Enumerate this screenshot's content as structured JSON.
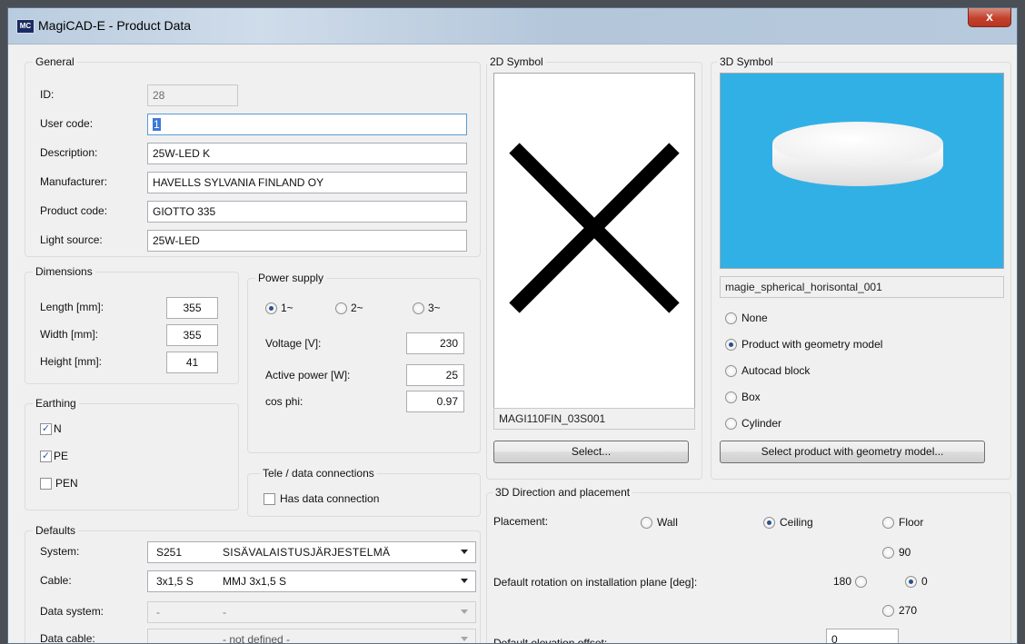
{
  "window": {
    "title": "MagiCAD-E - Product Data",
    "icon_text": "MC",
    "close_label": "x"
  },
  "general": {
    "legend": "General",
    "id_label": "ID:",
    "id_value": "28",
    "user_code_label": "User code:",
    "user_code_value": "1",
    "description_label": "Description:",
    "description_value": "25W-LED K",
    "manufacturer_label": "Manufacturer:",
    "manufacturer_value": "HAVELLS SYLVANIA FINLAND OY",
    "product_code_label": "Product code:",
    "product_code_value": "GIOTTO 335",
    "light_source_label": "Light source:",
    "light_source_value": "25W-LED"
  },
  "dimensions": {
    "legend": "Dimensions",
    "length_label": "Length [mm]:",
    "length_value": "355",
    "width_label": "Width [mm]:",
    "width_value": "355",
    "height_label": "Height [mm]:",
    "height_value": "41"
  },
  "power": {
    "legend": "Power supply",
    "phase_1": "1~",
    "phase_2": "2~",
    "phase_3": "3~",
    "selected_phase": "1~",
    "voltage_label": "Voltage [V]:",
    "voltage_value": "230",
    "active_power_label": "Active power [W]:",
    "active_power_value": "25",
    "cos_phi_label": "cos phi:",
    "cos_phi_value": "0.97"
  },
  "earthing": {
    "legend": "Earthing",
    "n_label": "N",
    "n_checked": true,
    "pe_label": "PE",
    "pe_checked": true,
    "pen_label": "PEN",
    "pen_checked": false
  },
  "tele": {
    "legend": "Tele / data connections",
    "has_data_label": "Has data connection",
    "has_data_checked": false
  },
  "defaults": {
    "legend": "Defaults",
    "system_label": "System:",
    "system_code": "S251",
    "system_name": "SISÄVALAISTUSJÄRJESTELMÄ",
    "cable_label": "Cable:",
    "cable_code": "3x1,5 S",
    "cable_name": "MMJ 3x1,5 S",
    "data_system_label": "Data system:",
    "data_system_code": "-",
    "data_system_name": "-",
    "data_cable_label": "Data cable:",
    "data_cable_code": "",
    "data_cable_name": "- not defined -"
  },
  "symbol2d": {
    "legend": "2D Symbol",
    "name": "MAGI110FIN_03S001",
    "select_label": "Select..."
  },
  "symbol3d": {
    "legend": "3D Symbol",
    "name": "magie_spherical_horisontal_001",
    "options": [
      "None",
      "Product with geometry model",
      "Autocad block",
      "Box",
      "Cylinder"
    ],
    "selected": "Product with geometry model",
    "select_label": "Select product with geometry model...",
    "preview_bg": "#31b0e6"
  },
  "direction": {
    "legend": "3D Direction and placement",
    "placement_label": "Placement:",
    "wall_label": "Wall",
    "ceiling_label": "Ceiling",
    "floor_label": "Floor",
    "selected_placement": "Ceiling",
    "rotation_label": "Default rotation on installation plane [deg]:",
    "rot_90": "90",
    "rot_180": "180",
    "rot_0": "0",
    "rot_270": "270",
    "selected_rotation": "0",
    "elevation_label": "Default elevation offset:",
    "elevation_value": "0"
  }
}
